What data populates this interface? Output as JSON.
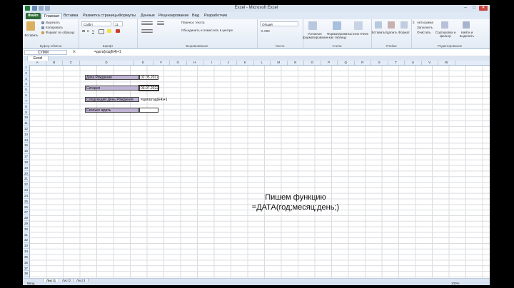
{
  "window": {
    "title": "Excel - Microsoft Excel"
  },
  "tabs": [
    "Файл",
    "Главная",
    "Вставка",
    "Разметка страницы",
    "Формулы",
    "Данные",
    "Рецензирование",
    "Вид",
    "Разработчик"
  ],
  "ribbon": {
    "paste": "Вставить",
    "cut": "Вырезать",
    "copy": "Копировать",
    "format_painter": "Формат по образцу",
    "clipboard": "Буфер обмена",
    "font_name": "Calibri",
    "font_size": "11",
    "font": "Шрифт",
    "wrap_text": "Перенос текста",
    "merge": "Объединить и поместить в центре",
    "alignment": "Выравнивание",
    "number_format": "Общий",
    "number": "Число",
    "cond_format": "Условное форматирование",
    "format_table": "Форматировать как таблицу",
    "cell_styles": "Стили ячеек",
    "styles": "Стили",
    "insert": "Вставить",
    "delete": "Удалить",
    "format": "Формат",
    "cells": "Ячейки",
    "autosum": "Автосумма",
    "fill": "Заполнить",
    "clear": "Очистить",
    "sort_filter": "Сортировка и фильтр",
    "find_select": "Найти и выделить",
    "editing": "Редактирование"
  },
  "formula_bar": {
    "name_box": "СУММ",
    "fx": "fx",
    "formula": "=дата(год(E4)+1"
  },
  "workbook_tab": "Excel",
  "columns": [
    "A",
    "B",
    "C",
    "D",
    "E",
    "F",
    "G",
    "H",
    "I",
    "J",
    "K",
    "L",
    "M",
    "N",
    "O",
    "P",
    "Q",
    "R",
    "S",
    "T",
    "U",
    "V",
    "W"
  ],
  "rows": [
    "1",
    "2",
    "3",
    "4",
    "5",
    "6",
    "7",
    "8",
    "9",
    "10",
    "11",
    "12",
    "13",
    "14",
    "15",
    "16",
    "17",
    "18",
    "19",
    "20",
    "21",
    "22",
    "23",
    "24",
    "25",
    "26",
    "27",
    "28",
    "29",
    "30",
    "31",
    "32",
    "33",
    "34",
    "35",
    "36",
    "37",
    "38"
  ],
  "cells": {
    "d2": "Дата Рождения",
    "e2": "02.05.2017",
    "d4": "Сегодня",
    "e4": "03.07.2022",
    "d6": "Следующий День Рождения",
    "e6": "=дата(год(E4)+1",
    "d8": "Сколько ждать",
    "e8": ""
  },
  "annotation": {
    "line1": "Пишем функцию",
    "line2": "=ДАТА(год;месяц;день;)"
  },
  "sheets": [
    "Лист1",
    "Лист2",
    "Лист3"
  ],
  "status": {
    "mode": "Ввод",
    "zoom": "100%"
  },
  "colors": {
    "label_fill": "#c0b4d4",
    "file_tab": "#2d6a35"
  }
}
